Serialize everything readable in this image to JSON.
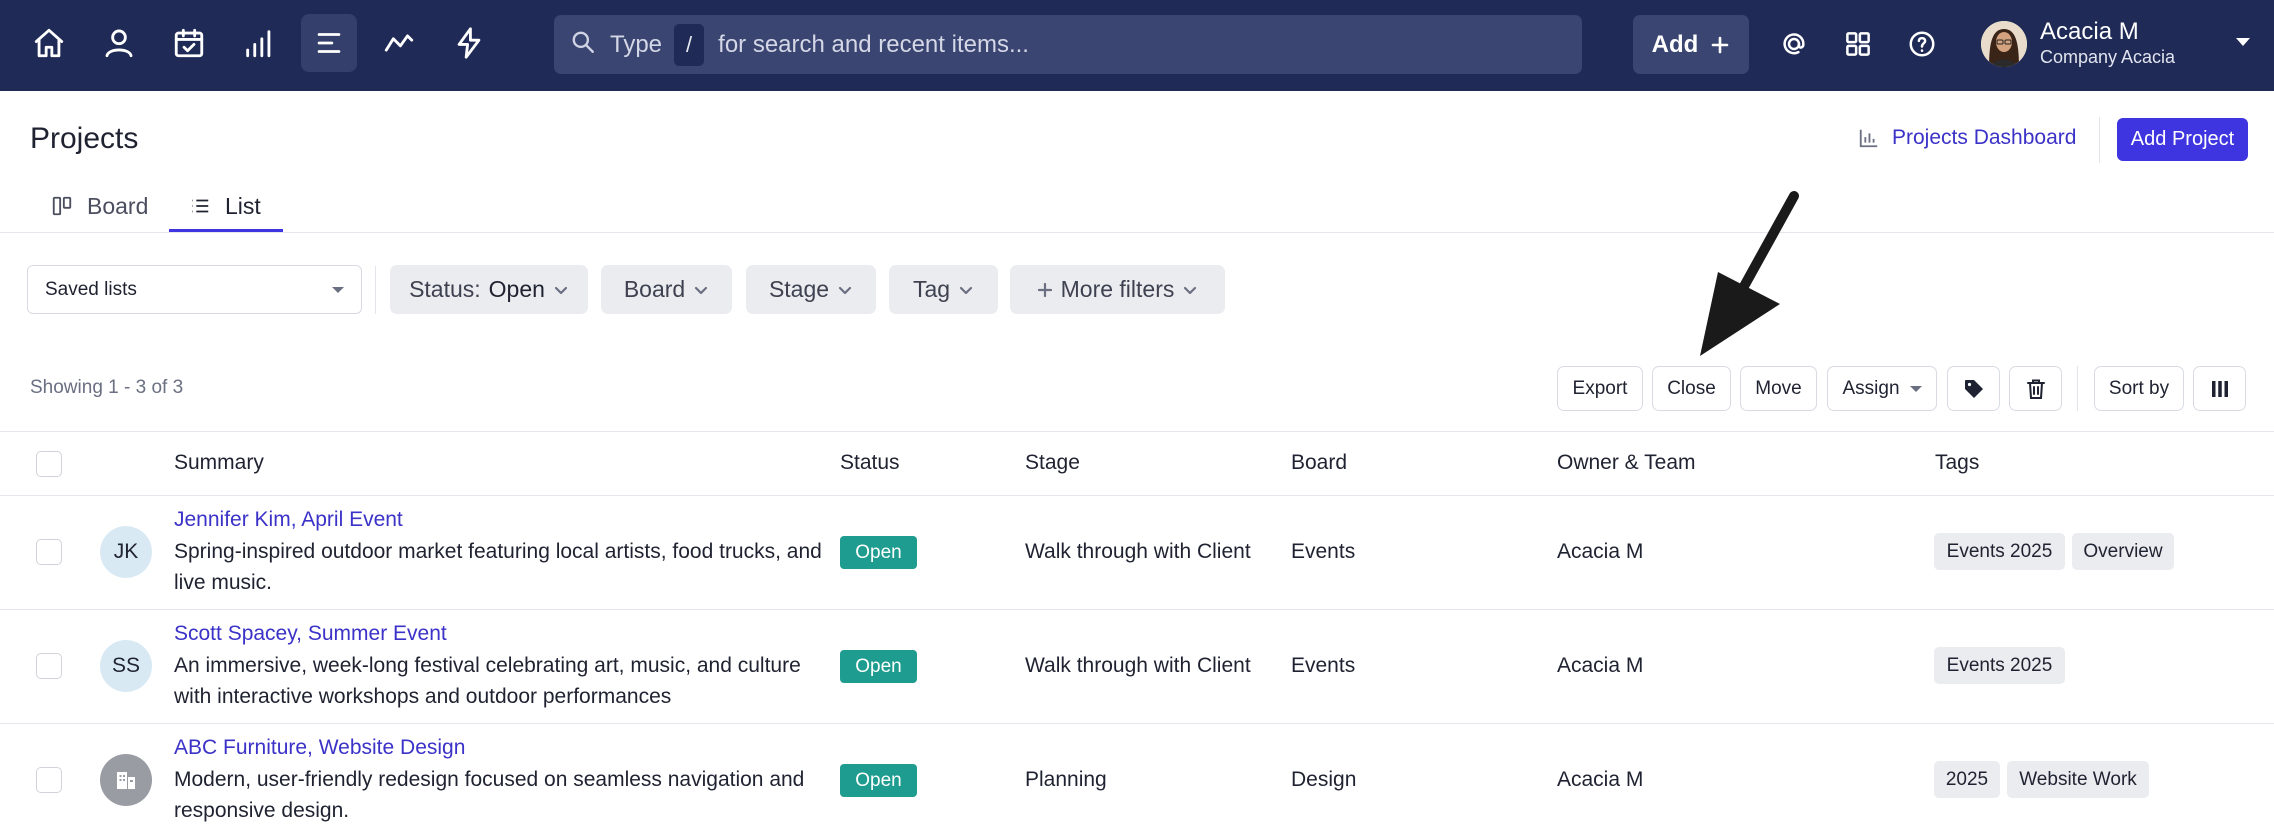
{
  "nav": {
    "icons": [
      "home-icon",
      "user-icon",
      "calendar-check-icon",
      "signal-bars-icon",
      "list-lines-icon",
      "trend-line-icon",
      "lightning-icon"
    ],
    "active_index": 4
  },
  "search": {
    "type_label": "Type",
    "shortcut": "/",
    "hint": "for search and recent items..."
  },
  "add_button": {
    "label": "Add"
  },
  "user": {
    "name": "Acacia M",
    "company": "Company Acacia"
  },
  "page": {
    "title": "Projects",
    "dashboard_link": "Projects Dashboard",
    "add_project": "Add Project"
  },
  "tabs": [
    {
      "label": "Board",
      "active": false
    },
    {
      "label": "List",
      "active": true
    }
  ],
  "filters": {
    "saved_lists": "Saved lists",
    "status_label": "Status:",
    "status_value": "Open",
    "board": "Board",
    "stage": "Stage",
    "tag": "Tag",
    "more": "More filters"
  },
  "toolbar": {
    "showing": "Showing 1 - 3 of 3",
    "export": "Export",
    "close": "Close",
    "move": "Move",
    "assign": "Assign",
    "sort_by": "Sort by"
  },
  "table": {
    "headers": [
      "Summary",
      "Status",
      "Stage",
      "Board",
      "Owner & Team",
      "Tags"
    ],
    "rows": [
      {
        "initials": "JK",
        "title": "Jennifer Kim, April Event",
        "description": "Spring-inspired outdoor market featuring local artists, food trucks, and live music.",
        "status": "Open",
        "stage": "Walk through with Client",
        "board": "Events",
        "owner": "Acacia M",
        "tags": [
          "Events 2025",
          "Overview"
        ]
      },
      {
        "initials": "SS",
        "title": "Scott Spacey, Summer Event",
        "description": "An immersive, week-long festival celebrating art, music, and culture with interactive workshops and outdoor performances",
        "status": "Open",
        "stage": "Walk through with Client",
        "board": "Events",
        "owner": "Acacia M",
        "tags": [
          "Events 2025"
        ]
      },
      {
        "initials": "",
        "title": "ABC Furniture, Website Design",
        "description": "Modern, user-friendly redesign focused on seamless navigation and responsive design.",
        "status": "Open",
        "stage": "Planning",
        "board": "Design",
        "owner": "Acacia M",
        "tags": [
          "2025",
          "Website Work"
        ]
      }
    ]
  },
  "colors": {
    "nav_bg": "#1f2a56",
    "accent": "#3f35e0",
    "link": "#3b32c8",
    "status_open": "#1e9c8f"
  }
}
